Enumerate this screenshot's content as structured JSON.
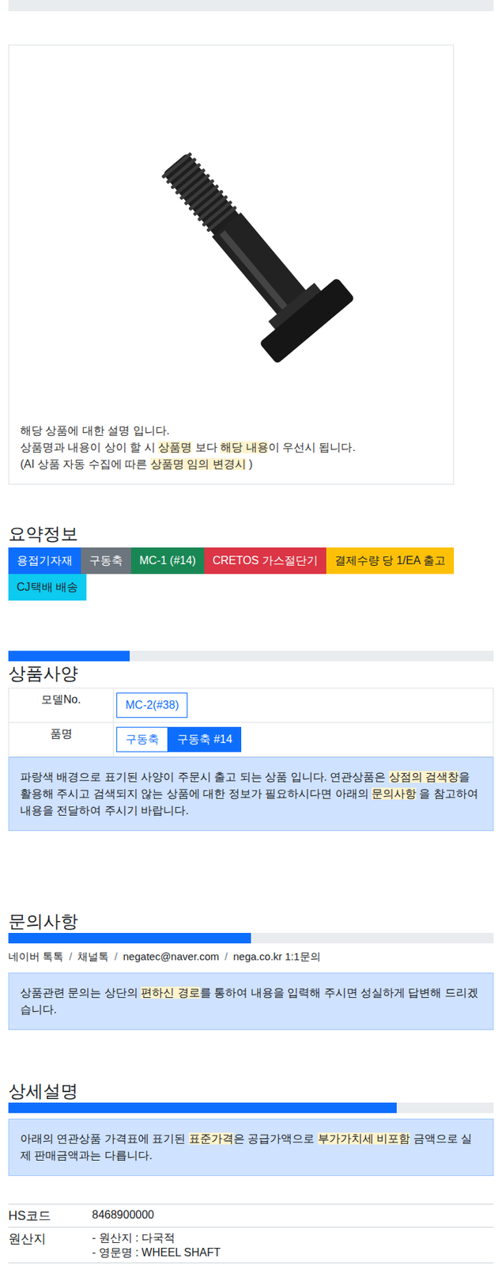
{
  "product_card": {
    "notice_lines": [
      [
        {
          "text": "해당 상품에 대한 설명 입니다.",
          "highlight": false
        }
      ],
      [
        {
          "text": "상품명과 내용이 상이 할 시 ",
          "highlight": false
        },
        {
          "text": "상품명",
          "highlight": true
        },
        {
          "text": " 보다 ",
          "highlight": false
        },
        {
          "text": "해당 내용",
          "highlight": true
        },
        {
          "text": "이 우선시 됩니다.",
          "highlight": false
        }
      ],
      [
        {
          "text": "(AI 상품 자동 수집에 따른 ",
          "highlight": false
        },
        {
          "text": "상품명 임의 변경시",
          "highlight": true
        },
        {
          "text": " )",
          "highlight": false
        }
      ]
    ]
  },
  "summary": {
    "title": "요약정보",
    "tags": [
      {
        "label": "용접기자재",
        "color": "#0d6efd",
        "dark_text": false
      },
      {
        "label": "구동축",
        "color": "#6c757d",
        "dark_text": false
      },
      {
        "label": "MC-1 (#14)",
        "color": "#198754",
        "dark_text": false
      },
      {
        "label": "CRETOS 가스절단기",
        "color": "#dc3545",
        "dark_text": false
      },
      {
        "label": "결제수량 당 1/EA 출고",
        "color": "#ffc107",
        "dark_text": true
      },
      {
        "label": "CJ택배 배송",
        "color": "#0dcaf0",
        "dark_text": true
      }
    ]
  },
  "spec": {
    "level": 0.25,
    "title": "상품사양",
    "rows": [
      {
        "label": "모델No.",
        "options": [
          {
            "label": "MC-2(#38)",
            "selected": false
          }
        ]
      },
      {
        "label": "품명",
        "options": [
          {
            "label": "구동축",
            "selected": false
          },
          {
            "label": "구동축 #14",
            "selected": true
          }
        ]
      }
    ],
    "note": [
      {
        "text": "파랑색 배경으로 표기된 사양이 주문시 출고 되는 상품 입니다. 연관상품은 ",
        "highlight": false
      },
      {
        "text": "상점의 검색창",
        "highlight": true
      },
      {
        "text": "을 활용해 주시고 검색되지 않는 상품에 대한 정보가 필요하시다면 아래의 ",
        "highlight": false
      },
      {
        "text": "문의사항",
        "highlight": true
      },
      {
        "text": " 을 참고하여 내용을 전달하여 주시기 바랍니다.",
        "highlight": false
      }
    ]
  },
  "inquiry": {
    "title": "문의사항",
    "level": 0.5,
    "channels": [
      "네이버 톡톡",
      "채널톡",
      "negatec@naver.com",
      "nega.co.kr 1:1문의"
    ],
    "separator": "/",
    "note": [
      {
        "text": "상품관련 문의는 상단의 ",
        "highlight": false
      },
      {
        "text": "편하신 경로",
        "highlight": true
      },
      {
        "text": "를 통하여 내용을 입력해 주시면 성실하게 답변해 드리겠습니다.",
        "highlight": false
      }
    ]
  },
  "detail": {
    "title": "상세설명",
    "level": 0.8,
    "note": [
      {
        "text": "아래의 연관상품 가격표에 표기된 ",
        "highlight": false
      },
      {
        "text": "표준가격",
        "highlight": true
      },
      {
        "text": "은 공급가액으로 ",
        "highlight": false
      },
      {
        "text": "부가가치세 비포함",
        "highlight": true
      },
      {
        "text": " 금액으로 실제 판매금액과는 다릅니다.",
        "highlight": false
      }
    ],
    "rows": [
      {
        "label": "HS코드",
        "values": [
          "8468900000"
        ]
      },
      {
        "label": "원산지",
        "values": [
          "- 원산지 : 다국적",
          "- 영문명 : WHEEL SHAFT"
        ]
      }
    ]
  }
}
